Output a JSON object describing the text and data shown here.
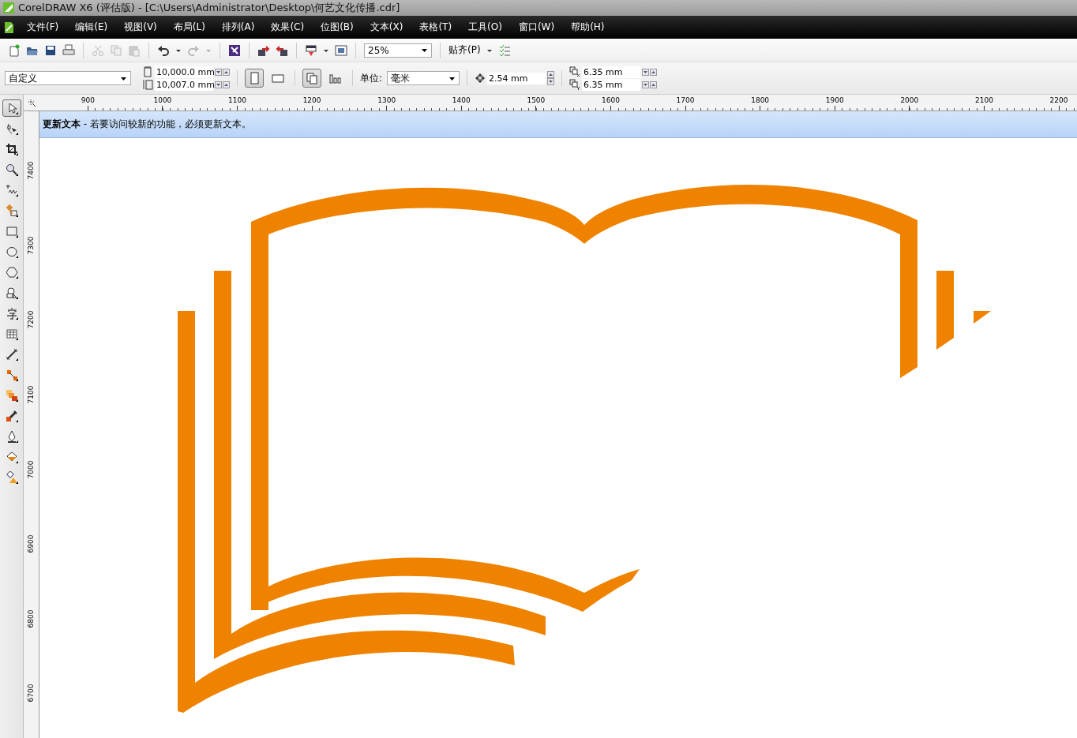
{
  "window": {
    "title": "CorelDRAW X6 (评估版) - [C:\\Users\\Administrator\\Desktop\\何艺文化传播.cdr]"
  },
  "menu": [
    "文件(F)",
    "编辑(E)",
    "视图(V)",
    "布局(L)",
    "排列(A)",
    "效果(C)",
    "位图(B)",
    "文本(X)",
    "表格(T)",
    "工具(O)",
    "窗口(W)",
    "帮助(H)"
  ],
  "toolbar": {
    "zoom": "25%",
    "snap": "贴齐(P)"
  },
  "property_bar": {
    "page_size": "自定义",
    "width": "10,000.0 mm",
    "height": "10,007.0 mm",
    "orientation": [
      {
        "kind": "portrait",
        "selected": true
      },
      {
        "kind": "landscape",
        "selected": false
      }
    ],
    "page_layout": [
      {
        "kind": "all",
        "selected": true
      },
      {
        "kind": "current",
        "selected": false
      }
    ],
    "units_label": "单位:",
    "units": "毫米",
    "nudge": "2.54 mm",
    "duplicate_x": "6.35 mm",
    "duplicate_y": "6.35 mm"
  },
  "toolbox": [
    {
      "selected": true
    },
    {
      "selected": false
    },
    {
      "selected": false
    },
    {
      "selected": false
    },
    {
      "selected": false
    },
    {
      "selected": false
    },
    {
      "selected": false
    },
    {
      "selected": false
    },
    {
      "selected": false
    },
    {
      "selected": false
    },
    {
      "selected": false
    },
    {
      "selected": false
    },
    {
      "selected": false
    },
    {
      "selected": false
    },
    {
      "selected": false
    },
    {
      "selected": false
    },
    {
      "selected": false
    },
    {
      "selected": false
    },
    {
      "selected": false
    }
  ],
  "ruler_horizontal": [
    "900",
    "1000",
    "1100",
    "1200",
    "1300",
    "1400",
    "1500",
    "1600",
    "1700",
    "1800",
    "1900",
    "2000",
    "2100",
    "2200"
  ],
  "ruler_vertical": [
    "7400",
    "7300",
    "7200",
    "7100",
    "7000",
    "6900",
    "6800",
    "6700"
  ],
  "notice": "**更新文本** - 若要访问较新的功能，必须更新文本。"
}
